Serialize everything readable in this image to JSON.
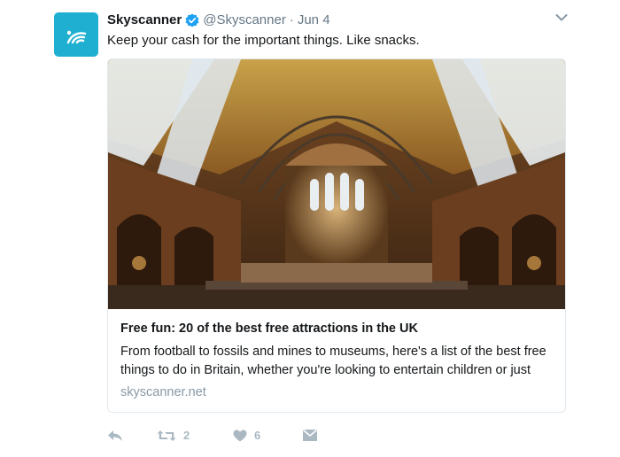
{
  "tweet": {
    "author_name": "Skyscanner",
    "handle": "@Skyscanner",
    "separator": "·",
    "date": "Jun 4",
    "text": "Keep your cash for the important things. Like snacks."
  },
  "card": {
    "title": "Free fun: 20 of the best free attractions in the UK",
    "description": "From football to fossils and mines to museums, here's a list of the best free things to do in Britain, whether you're looking to entertain children or just",
    "domain": "skyscanner.net"
  },
  "actions": {
    "retweet_count": "2",
    "like_count": "6"
  },
  "colors": {
    "brand": "#1fb0d1",
    "verified": "#1da1f2",
    "muted": "#657786",
    "action": "#aab8c2",
    "border": "#e1e8ed"
  },
  "icons": [
    "skyscanner-logo-icon",
    "verified-badge-icon",
    "chevron-down-icon",
    "reply-icon",
    "retweet-icon",
    "heart-icon",
    "direct-message-icon"
  ]
}
